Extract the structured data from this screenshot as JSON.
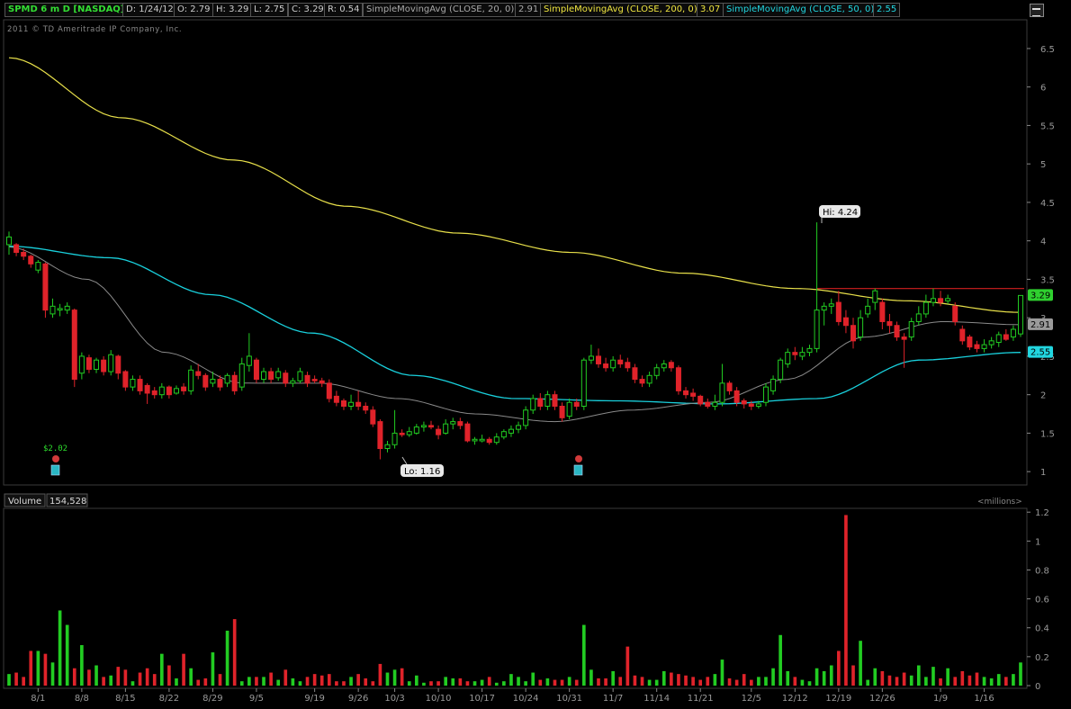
{
  "header": {
    "symbol": "SPMD 6 m D [NASDAQ]",
    "date": "D: 1/24/12",
    "open": "O: 2.79",
    "high": "H: 3.29",
    "low": "L: 2.75",
    "close": "C: 3.29",
    "range": "R: 0.54",
    "sma20_label": "SimpleMovingAvg (CLOSE, 20, 0)",
    "sma20_value": "2.91",
    "sma200_label": "SimpleMovingAvg (CLOSE, 200, 0)",
    "sma200_value": "3.07",
    "sma50_label": "SimpleMovingAvg (CLOSE, 50, 0)",
    "sma50_value": "2.55"
  },
  "copyright": "2011 © TD Ameritrade IP Company, Inc.",
  "volume_header": {
    "label": "Volume",
    "value": "154,528",
    "units": "<millions>"
  },
  "colors": {
    "up": "#22cc22",
    "down": "#e0232a",
    "sma20": "#8a8a8a",
    "sma50": "#19d0dc",
    "sma200": "#e8e04a",
    "resistance": "#d21f1f",
    "grid": "#2a2a2a",
    "axis": "#888888"
  },
  "chart_data": [
    {
      "type": "candlestick",
      "title": "SPMD 6 m D [NASDAQ]",
      "ylim": [
        0.85,
        6.85
      ],
      "y_ticks": [
        "6.5",
        "6",
        "5.5",
        "5",
        "4.5",
        "4",
        "3.5",
        "3",
        "2.5",
        "2",
        "1.5",
        "1"
      ],
      "x_ticks": [
        "8/1",
        "8/8",
        "8/15",
        "8/22",
        "8/29",
        "9/5",
        "9/19",
        "9/26",
        "10/3",
        "10/10",
        "10/17",
        "10/24",
        "10/31",
        "11/7",
        "11/14",
        "11/21",
        "12/5",
        "12/12",
        "12/19",
        "12/26",
        "1/9",
        "1/16"
      ],
      "annotations": [
        {
          "text": "Hi: 4.24",
          "value": 4.24
        },
        {
          "text": "Lo: 1.16",
          "value": 1.16
        },
        {
          "text": "$2.02",
          "kind": "dividend-marker"
        }
      ],
      "last_value_labels": [
        {
          "text": "3.29",
          "series": "price"
        },
        {
          "text": "2.91",
          "series": "SMA20"
        },
        {
          "text": "2.55",
          "series": "SMA50"
        }
      ],
      "resistance_level": 3.38,
      "candles": [
        [
          3.95,
          4.05,
          4.12,
          3.82
        ],
        [
          3.95,
          3.85,
          3.97,
          3.8
        ],
        [
          3.85,
          3.8,
          3.9,
          3.75
        ],
        [
          3.8,
          3.7,
          3.82,
          3.65
        ],
        [
          3.62,
          3.72,
          3.75,
          3.58
        ],
        [
          3.7,
          3.1,
          3.72,
          3.0
        ],
        [
          3.05,
          3.15,
          3.25,
          3.0
        ],
        [
          3.1,
          3.12,
          3.18,
          3.02
        ],
        [
          3.1,
          3.15,
          3.2,
          3.05
        ],
        [
          3.1,
          2.2,
          3.12,
          2.1
        ],
        [
          2.28,
          2.5,
          2.55,
          2.2
        ],
        [
          2.48,
          2.33,
          2.52,
          2.28
        ],
        [
          2.33,
          2.45,
          2.48,
          2.28
        ],
        [
          2.45,
          2.3,
          2.5,
          2.25
        ],
        [
          2.3,
          2.52,
          2.58,
          2.25
        ],
        [
          2.5,
          2.28,
          2.52,
          2.2
        ],
        [
          2.3,
          2.1,
          2.32,
          2.05
        ],
        [
          2.1,
          2.2,
          2.25,
          2.05
        ],
        [
          2.2,
          2.05,
          2.25,
          2.0
        ],
        [
          2.12,
          2.02,
          2.15,
          1.88
        ],
        [
          2.05,
          2.0,
          2.1,
          1.95
        ],
        [
          2.0,
          2.1,
          2.15,
          1.95
        ],
        [
          2.1,
          2.0,
          2.12,
          1.95
        ],
        [
          2.02,
          2.08,
          2.12,
          2.0
        ],
        [
          2.1,
          2.05,
          2.15,
          2.0
        ],
        [
          2.05,
          2.32,
          2.38,
          2.0
        ],
        [
          2.3,
          2.25,
          2.4,
          2.2
        ],
        [
          2.25,
          2.1,
          2.28,
          2.05
        ],
        [
          2.15,
          2.2,
          2.3,
          2.1
        ],
        [
          2.2,
          2.1,
          2.25,
          2.05
        ],
        [
          2.15,
          2.25,
          2.28,
          2.1
        ],
        [
          2.25,
          2.05,
          2.3,
          2.0
        ],
        [
          2.1,
          2.4,
          2.48,
          2.05
        ],
        [
          2.38,
          2.5,
          2.8,
          2.3
        ],
        [
          2.45,
          2.2,
          2.48,
          2.15
        ],
        [
          2.2,
          2.3,
          2.35,
          2.15
        ],
        [
          2.3,
          2.2,
          2.35,
          2.15
        ],
        [
          2.22,
          2.3,
          2.35,
          2.18
        ],
        [
          2.28,
          2.15,
          2.32,
          2.1
        ],
        [
          2.15,
          2.18,
          2.22,
          2.1
        ],
        [
          2.18,
          2.3,
          2.35,
          2.15
        ],
        [
          2.25,
          2.15,
          2.3,
          2.1
        ],
        [
          2.2,
          2.18,
          2.25,
          2.15
        ],
        [
          2.18,
          2.15,
          2.22,
          2.1
        ],
        [
          2.15,
          1.95,
          2.2,
          1.9
        ],
        [
          1.98,
          1.9,
          2.05,
          1.85
        ],
        [
          1.92,
          1.85,
          1.95,
          1.8
        ],
        [
          1.85,
          1.9,
          2.0,
          1.8
        ],
        [
          1.9,
          1.85,
          2.05,
          1.8
        ],
        [
          1.85,
          1.8,
          1.9,
          1.75
        ],
        [
          1.8,
          1.62,
          1.85,
          1.58
        ],
        [
          1.65,
          1.3,
          1.68,
          1.16
        ],
        [
          1.3,
          1.35,
          1.4,
          1.25
        ],
        [
          1.35,
          1.5,
          1.8,
          1.3
        ],
        [
          1.5,
          1.48,
          1.55,
          1.45
        ],
        [
          1.48,
          1.52,
          1.58,
          1.45
        ],
        [
          1.5,
          1.58,
          1.62,
          1.48
        ],
        [
          1.58,
          1.6,
          1.65,
          1.52
        ],
        [
          1.6,
          1.58,
          1.66,
          1.55
        ],
        [
          1.55,
          1.48,
          1.6,
          1.42
        ],
        [
          1.5,
          1.62,
          1.68,
          1.48
        ],
        [
          1.62,
          1.65,
          1.7,
          1.55
        ],
        [
          1.65,
          1.6,
          1.7,
          1.55
        ],
        [
          1.62,
          1.4,
          1.65,
          1.38
        ],
        [
          1.4,
          1.42,
          1.45,
          1.35
        ],
        [
          1.4,
          1.42,
          1.48,
          1.38
        ],
        [
          1.42,
          1.38,
          1.45,
          1.35
        ],
        [
          1.38,
          1.45,
          1.5,
          1.35
        ],
        [
          1.45,
          1.52,
          1.55,
          1.42
        ],
        [
          1.5,
          1.55,
          1.6,
          1.45
        ],
        [
          1.55,
          1.6,
          1.65,
          1.5
        ],
        [
          1.6,
          1.8,
          1.85,
          1.55
        ],
        [
          1.8,
          1.95,
          2.0,
          1.75
        ],
        [
          1.95,
          1.85,
          2.02,
          1.8
        ],
        [
          1.85,
          2.0,
          2.05,
          1.8
        ],
        [
          2.0,
          1.85,
          2.05,
          1.8
        ],
        [
          1.85,
          1.7,
          1.9,
          1.65
        ],
        [
          1.72,
          1.9,
          1.95,
          1.68
        ],
        [
          1.9,
          1.85,
          1.95,
          1.8
        ],
        [
          1.85,
          2.45,
          2.48,
          1.8
        ],
        [
          2.45,
          2.5,
          2.65,
          2.4
        ],
        [
          2.5,
          2.4,
          2.6,
          2.35
        ],
        [
          2.4,
          2.35,
          2.48,
          2.3
        ],
        [
          2.35,
          2.45,
          2.5,
          2.3
        ],
        [
          2.45,
          2.4,
          2.52,
          2.35
        ],
        [
          2.42,
          2.35,
          2.48,
          2.3
        ],
        [
          2.35,
          2.2,
          2.4,
          2.15
        ],
        [
          2.2,
          2.15,
          2.25,
          2.1
        ],
        [
          2.15,
          2.25,
          2.3,
          2.1
        ],
        [
          2.25,
          2.35,
          2.4,
          2.2
        ],
        [
          2.35,
          2.4,
          2.45,
          2.3
        ],
        [
          2.42,
          2.35,
          2.45,
          2.3
        ],
        [
          2.35,
          2.05,
          2.38,
          2.0
        ],
        [
          2.05,
          2.0,
          2.1,
          1.95
        ],
        [
          2.02,
          1.98,
          2.08,
          1.92
        ],
        [
          1.98,
          1.88,
          2.0,
          1.85
        ],
        [
          1.9,
          1.85,
          1.95,
          1.82
        ],
        [
          1.85,
          1.9,
          2.0,
          1.8
        ],
        [
          1.9,
          2.15,
          2.4,
          1.85
        ],
        [
          2.15,
          2.05,
          2.18,
          2.0
        ],
        [
          2.05,
          1.9,
          2.1,
          1.85
        ],
        [
          1.92,
          1.88,
          1.95,
          1.82
        ],
        [
          1.88,
          1.85,
          1.92,
          1.8
        ],
        [
          1.85,
          1.88,
          1.92,
          1.82
        ],
        [
          1.9,
          2.1,
          2.15,
          1.85
        ],
        [
          2.05,
          2.2,
          2.25,
          2.0
        ],
        [
          2.2,
          2.45,
          2.48,
          2.15
        ],
        [
          2.4,
          2.55,
          2.6,
          2.35
        ],
        [
          2.55,
          2.52,
          2.62,
          2.45
        ],
        [
          2.5,
          2.55,
          2.62,
          2.45
        ],
        [
          2.55,
          2.6,
          2.65,
          2.5
        ],
        [
          2.6,
          3.1,
          4.24,
          2.55
        ],
        [
          3.1,
          3.15,
          3.2,
          2.9
        ],
        [
          3.15,
          3.18,
          3.25,
          3.05
        ],
        [
          3.2,
          2.95,
          3.35,
          2.9
        ],
        [
          3.0,
          2.9,
          3.1,
          2.8
        ],
        [
          2.9,
          2.7,
          3.0,
          2.6
        ],
        [
          2.75,
          3.0,
          3.1,
          2.7
        ],
        [
          3.05,
          3.15,
          3.25,
          3.0
        ],
        [
          3.2,
          3.35,
          3.38,
          3.1
        ],
        [
          3.2,
          2.95,
          3.25,
          2.85
        ],
        [
          2.95,
          2.9,
          3.05,
          2.8
        ],
        [
          2.9,
          2.75,
          2.95,
          2.7
        ],
        [
          2.75,
          2.72,
          2.8,
          2.35
        ],
        [
          2.75,
          2.95,
          3.0,
          2.7
        ],
        [
          2.95,
          3.05,
          3.15,
          2.9
        ],
        [
          3.05,
          3.2,
          3.3,
          3.0
        ],
        [
          3.2,
          3.25,
          3.38,
          3.15
        ],
        [
          3.25,
          3.2,
          3.35,
          3.15
        ],
        [
          3.22,
          3.25,
          3.3,
          3.18
        ],
        [
          3.15,
          2.95,
          3.2,
          2.9
        ],
        [
          2.85,
          2.7,
          2.9,
          2.65
        ],
        [
          2.75,
          2.62,
          2.78,
          2.58
        ],
        [
          2.65,
          2.6,
          2.7,
          2.55
        ],
        [
          2.6,
          2.65,
          2.72,
          2.55
        ],
        [
          2.65,
          2.7,
          2.75,
          2.6
        ],
        [
          2.68,
          2.78,
          2.82,
          2.62
        ],
        [
          2.78,
          2.72,
          2.85,
          2.7
        ],
        [
          2.75,
          2.85,
          2.9,
          2.7
        ],
        [
          2.79,
          3.29,
          3.29,
          2.75
        ]
      ],
      "sma200": [
        6.38,
        5.6,
        5.05,
        4.45,
        4.1,
        3.85,
        3.58,
        3.38,
        3.22,
        3.07
      ],
      "sma50": [
        3.93,
        3.78,
        3.3,
        2.8,
        2.25,
        1.95,
        1.92,
        1.88,
        1.95,
        2.45,
        2.55
      ],
      "sma20": [
        3.92,
        3.5,
        2.55,
        2.15,
        2.15,
        1.95,
        1.75,
        1.65,
        1.8,
        1.9,
        2.2,
        2.75,
        2.95,
        2.91
      ]
    },
    {
      "type": "bar",
      "title": "Volume",
      "units": "millions",
      "ylim": [
        0,
        1.22
      ],
      "y_ticks": [
        "1.2",
        "1",
        "0.8",
        "0.6",
        "0.4",
        "0.2",
        "0"
      ],
      "values": [
        0.08,
        0.09,
        0.06,
        0.24,
        0.24,
        0.22,
        0.16,
        0.52,
        0.42,
        0.12,
        0.28,
        0.11,
        0.14,
        0.06,
        0.07,
        0.13,
        0.11,
        0.03,
        0.09,
        0.12,
        0.08,
        0.22,
        0.14,
        0.05,
        0.22,
        0.12,
        0.04,
        0.05,
        0.23,
        0.08,
        0.38,
        0.46,
        0.03,
        0.06,
        0.06,
        0.06,
        0.09,
        0.04,
        0.11,
        0.05,
        0.03,
        0.06,
        0.08,
        0.07,
        0.08,
        0.03,
        0.03,
        0.06,
        0.08,
        0.05,
        0.03,
        0.15,
        0.09,
        0.11,
        0.12,
        0.03,
        0.07,
        0.02,
        0.03,
        0.03,
        0.06,
        0.05,
        0.05,
        0.03,
        0.03,
        0.04,
        0.06,
        0.02,
        0.03,
        0.08,
        0.06,
        0.03,
        0.09,
        0.04,
        0.05,
        0.04,
        0.04,
        0.06,
        0.04,
        0.42,
        0.11,
        0.05,
        0.05,
        0.1,
        0.06,
        0.27,
        0.07,
        0.06,
        0.04,
        0.04,
        0.1,
        0.09,
        0.08,
        0.07,
        0.06,
        0.04,
        0.06,
        0.08,
        0.18,
        0.05,
        0.04,
        0.08,
        0.04,
        0.06,
        0.06,
        0.12,
        0.35,
        0.1,
        0.06,
        0.04,
        0.03,
        0.12,
        0.1,
        0.14,
        0.24,
        1.18,
        0.14,
        0.31,
        0.04,
        0.12,
        0.1,
        0.07,
        0.06,
        0.09,
        0.07,
        0.14,
        0.06,
        0.13,
        0.05,
        0.12,
        0.06,
        0.1,
        0.07,
        0.09,
        0.06,
        0.05,
        0.08,
        0.06,
        0.08,
        0.16
      ]
    }
  ]
}
